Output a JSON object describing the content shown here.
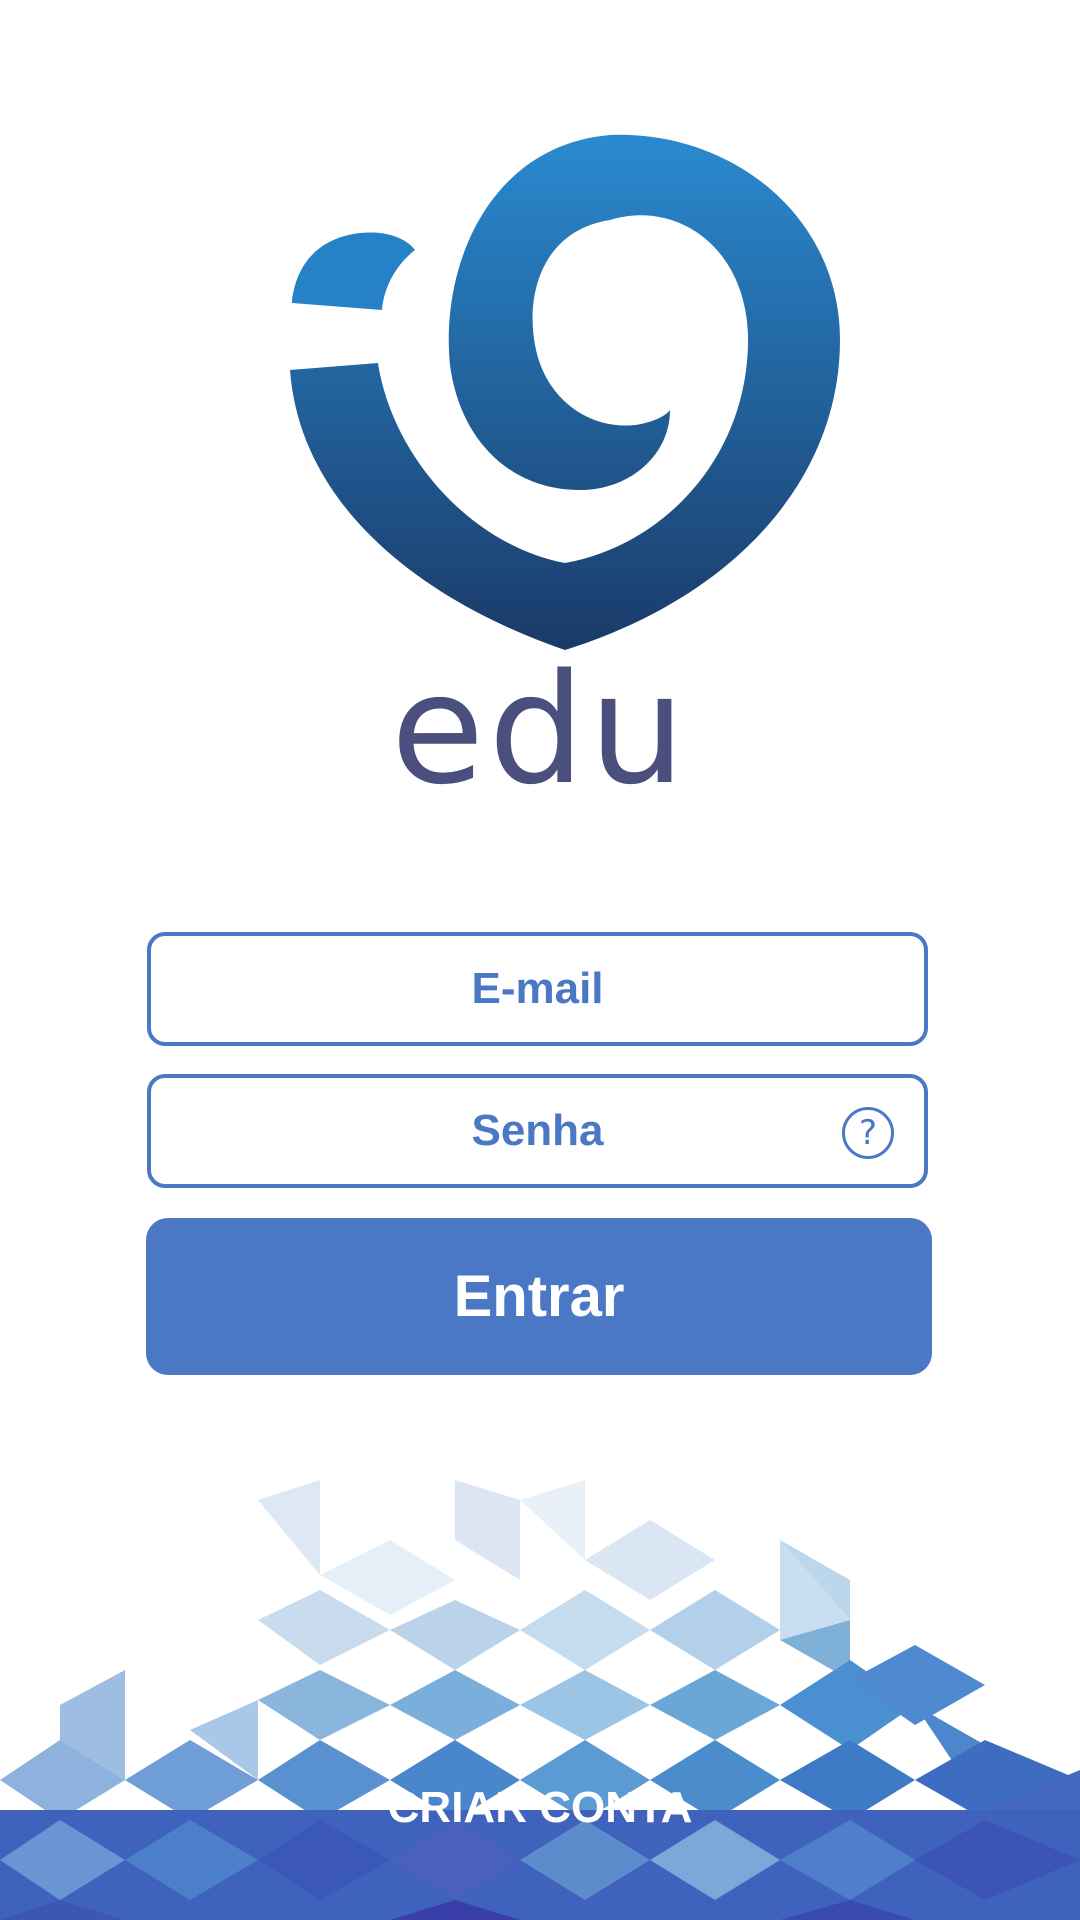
{
  "brand": {
    "name": "edu",
    "colors": {
      "logo_top": "#2a8ad0",
      "logo_bottom": "#1a3a68",
      "wordmark": "#4a4f7e",
      "accent": "#4a78c4"
    }
  },
  "form": {
    "email_placeholder": "E-mail",
    "password_placeholder": "Senha",
    "help_icon_glyph": "?",
    "submit_label": "Entrar"
  },
  "footer": {
    "create_account_label": "CRIAR CONTA"
  },
  "icons": {
    "logo": "heart-swirl-logo",
    "help": "question-circle-icon",
    "background": "blue-triangle-mosaic"
  }
}
